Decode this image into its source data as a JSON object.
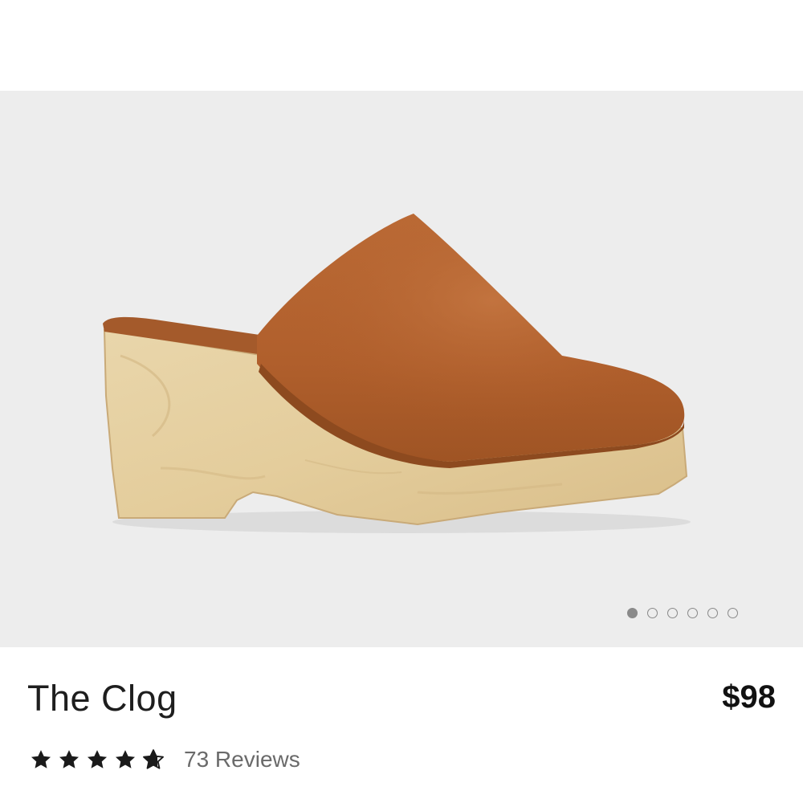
{
  "product": {
    "name": "The Clog",
    "price": "$98",
    "rating": 4.7,
    "rating_max": 5,
    "reviews_label": "73 Reviews"
  },
  "gallery": {
    "image_count": 6,
    "active_index": 0,
    "image_icon": "brown-leather-clog-with-wooden-sole"
  },
  "colors": {
    "gallery_background": "#ededed",
    "leather": "#b3632f",
    "wood": "#e6cf9f",
    "star": "#1a1a1a",
    "dot": "#8a8a8a"
  }
}
